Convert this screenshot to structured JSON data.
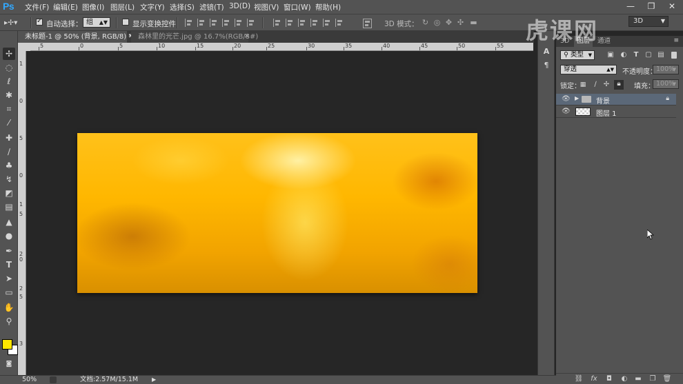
{
  "app": {
    "logo": "Ps"
  },
  "menu": [
    "文件(F)",
    "编辑(E)",
    "图像(I)",
    "图层(L)",
    "文字(Y)",
    "选择(S)",
    "滤镜(T)",
    "3D(D)",
    "视图(V)",
    "窗口(W)",
    "帮助(H)"
  ],
  "window_controls": {
    "minimize": "—",
    "restore": "❐",
    "close": "✕"
  },
  "options_bar": {
    "auto_select_label": "自动选择：",
    "auto_select_checked": true,
    "auto_select_value": "组",
    "show_transform_label": "显示变换控件",
    "show_transform_checked": false,
    "mode_3d_label": "3D 模式：",
    "workspace": "3D"
  },
  "tabs": [
    {
      "title": "未标题-1 @ 50% (背景, RGB/8) *",
      "active": true
    },
    {
      "title": "森林里的光芒.jpg @ 16.7%(RGB/8#)",
      "active": false
    }
  ],
  "ruler_h": [
    "5",
    "0",
    "5",
    "10",
    "15",
    "20",
    "25",
    "30",
    "35",
    "40",
    "45",
    "50",
    "55"
  ],
  "ruler_v": [
    "1",
    "0",
    "5",
    "0",
    "1",
    "5",
    "2",
    "0",
    "2",
    "5",
    "3"
  ],
  "panel": {
    "tabs": [
      "3D",
      "图层",
      "通道"
    ],
    "filter_kind": "类型",
    "blend_mode": "穿透",
    "opacity_label": "不透明度：",
    "opacity_value": "100%",
    "lock_label": "锁定：",
    "fill_label": "填充：",
    "fill_value": "100%",
    "layers": [
      {
        "name": "背景",
        "type": "group",
        "selected": true,
        "locked": true
      },
      {
        "name": "图层 1",
        "type": "layer",
        "selected": false,
        "locked": false
      }
    ]
  },
  "status": {
    "zoom": "50%",
    "doc_info": "文档:2.57M/15.1M"
  },
  "colors": {
    "foreground": "#ffe600",
    "background": "#ffffff",
    "accent": "#31a8ff"
  },
  "watermark": "虎课网"
}
